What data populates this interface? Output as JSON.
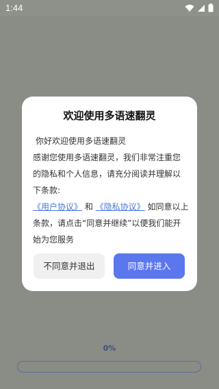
{
  "status_bar": {
    "time": "1:44",
    "icons": [
      "wifi-icon",
      "signal-icon",
      "battery-icon"
    ]
  },
  "dialog": {
    "title": "欢迎使用多语速翻灵",
    "greeting": "你好欢迎使用多语速翻灵",
    "para_lines": [
      "感谢您使用多语速翻灵，我们非常注重您",
      "的隐私和个人信息，请充分阅读并理解以",
      "下条款:"
    ],
    "user_agreement_link": "《用户协议》",
    "and_text": " 和 ",
    "privacy_policy_link": "《隐私协议》",
    "after_links": " 如同意以上",
    "closing_lines": [
      "条款，请点击“同意并继续”以便我们能开",
      "始为您服务"
    ],
    "decline_button": "不同意并退出",
    "accept_button": "同意并进入"
  },
  "loading": {
    "percent_label": "0%",
    "progress": 0
  },
  "colors": {
    "accent": "#5b77ee",
    "link": "#4a78d6",
    "overlay": "#8a8c86"
  }
}
